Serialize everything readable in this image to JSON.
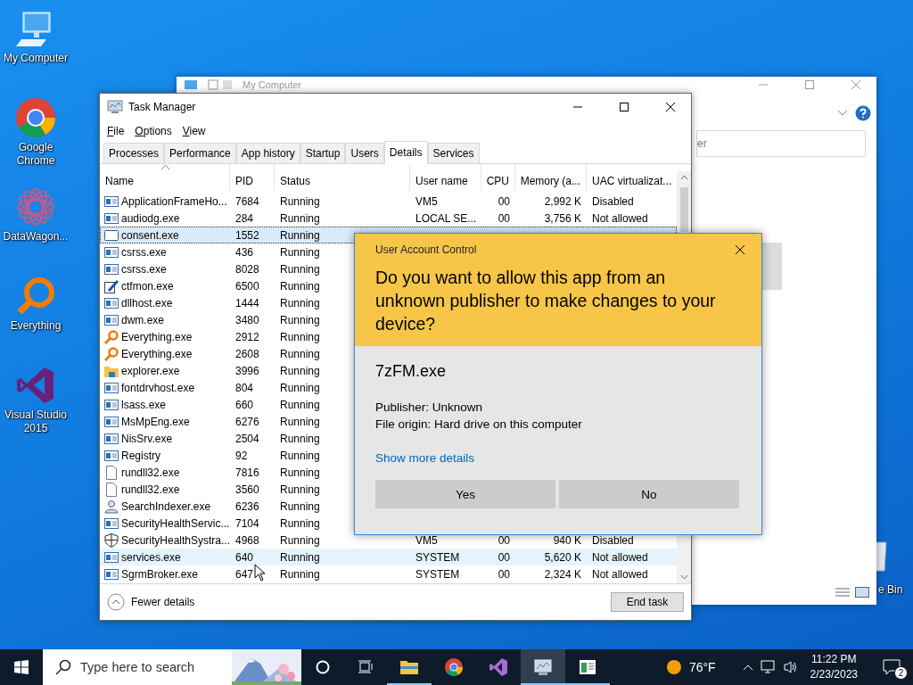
{
  "desktop_icons": [
    {
      "label": "My Computer",
      "kind": "monitor"
    },
    {
      "label": "Google Chrome",
      "kind": "chrome"
    },
    {
      "label": "DataWagon...",
      "kind": "flower"
    },
    {
      "label": "Everything",
      "kind": "magnifier"
    },
    {
      "label": "Visual Studio 2015",
      "kind": "vs"
    }
  ],
  "recycle_bin": {
    "label": "e Bin"
  },
  "explorer": {
    "title": "My Computer",
    "search_text": "er"
  },
  "task_manager": {
    "title": "Task Manager",
    "menu": [
      "File",
      "Options",
      "View"
    ],
    "tabs": [
      {
        "label": "Processes",
        "selected": false
      },
      {
        "label": "Performance",
        "selected": false
      },
      {
        "label": "App history",
        "selected": false
      },
      {
        "label": "Startup",
        "selected": false
      },
      {
        "label": "Users",
        "selected": false
      },
      {
        "label": "Details",
        "selected": true
      },
      {
        "label": "Services",
        "selected": false
      }
    ],
    "columns": [
      {
        "label": "Name",
        "sorted": true
      },
      {
        "label": "PID",
        "sorted": false
      },
      {
        "label": "Status",
        "sorted": false
      },
      {
        "label": "User name",
        "sorted": false
      },
      {
        "label": "CPU",
        "sorted": false
      },
      {
        "label": "Memory (a...",
        "sorted": false
      },
      {
        "label": "UAC virtualizat...",
        "sorted": false
      }
    ],
    "rows": [
      {
        "kind": "app",
        "cells": [
          "ApplicationFrameHo...",
          "7684",
          "Running",
          "VM5",
          "00",
          "2,992 K",
          "Disabled"
        ],
        "selected": false,
        "hovered": false
      },
      {
        "kind": "app",
        "cells": [
          "audiodg.exe",
          "284",
          "Running",
          "LOCAL SE...",
          "00",
          "3,756 K",
          "Not allowed"
        ],
        "selected": false,
        "hovered": false
      },
      {
        "kind": "frame",
        "cells": [
          "consent.exe",
          "1552",
          "Running"
        ],
        "selected": true,
        "hovered": false
      },
      {
        "kind": "app",
        "cells": [
          "csrss.exe",
          "436",
          "Running"
        ],
        "selected": false,
        "hovered": false
      },
      {
        "kind": "app",
        "cells": [
          "csrss.exe",
          "8028",
          "Running"
        ],
        "selected": false,
        "hovered": false
      },
      {
        "kind": "pen",
        "cells": [
          "ctfmon.exe",
          "6500",
          "Running"
        ],
        "selected": false,
        "hovered": false
      },
      {
        "kind": "app",
        "cells": [
          "dllhost.exe",
          "1444",
          "Running"
        ],
        "selected": false,
        "hovered": false
      },
      {
        "kind": "app",
        "cells": [
          "dwm.exe",
          "3480",
          "Running"
        ],
        "selected": false,
        "hovered": false
      },
      {
        "kind": "magnifier",
        "cells": [
          "Everything.exe",
          "2912",
          "Running"
        ],
        "selected": false,
        "hovered": false
      },
      {
        "kind": "magnifier",
        "cells": [
          "Everything.exe",
          "2608",
          "Running"
        ],
        "selected": false,
        "hovered": false
      },
      {
        "kind": "folder",
        "cells": [
          "explorer.exe",
          "3996",
          "Running"
        ],
        "selected": false,
        "hovered": false
      },
      {
        "kind": "app",
        "cells": [
          "fontdrvhost.exe",
          "804",
          "Running"
        ],
        "selected": false,
        "hovered": false
      },
      {
        "kind": "app",
        "cells": [
          "lsass.exe",
          "660",
          "Running"
        ],
        "selected": false,
        "hovered": false
      },
      {
        "kind": "app",
        "cells": [
          "MsMpEng.exe",
          "6276",
          "Running"
        ],
        "selected": false,
        "hovered": false
      },
      {
        "kind": "app",
        "cells": [
          "NisSrv.exe",
          "2504",
          "Running"
        ],
        "selected": false,
        "hovered": false
      },
      {
        "kind": "app",
        "cells": [
          "Registry",
          "92",
          "Running"
        ],
        "selected": false,
        "hovered": false
      },
      {
        "kind": "page",
        "cells": [
          "rundll32.exe",
          "7816",
          "Running"
        ],
        "selected": false,
        "hovered": false
      },
      {
        "kind": "page",
        "cells": [
          "rundll32.exe",
          "3560",
          "Running"
        ],
        "selected": false,
        "hovered": false
      },
      {
        "kind": "person",
        "cells": [
          "SearchIndexer.exe",
          "6236",
          "Running"
        ],
        "selected": false,
        "hovered": false
      },
      {
        "kind": "app",
        "cells": [
          "SecurityHealthServic...",
          "7104",
          "Running"
        ],
        "selected": false,
        "hovered": false
      },
      {
        "kind": "shield",
        "cells": [
          "SecurityHealthSystra...",
          "4968",
          "Running",
          "VM5",
          "00",
          "940 K",
          "Disabled"
        ],
        "selected": false,
        "hovered": false
      },
      {
        "kind": "app",
        "cells": [
          "services.exe",
          "640",
          "Running",
          "SYSTEM",
          "00",
          "5,620 K",
          "Not allowed"
        ],
        "selected": false,
        "hovered": true
      },
      {
        "kind": "app",
        "cells": [
          "SgrmBroker.exe",
          "647",
          "Running",
          "SYSTEM",
          "00",
          "2,324 K",
          "Not allowed"
        ],
        "selected": false,
        "hovered": false
      }
    ],
    "details_toggle": "Fewer details",
    "end_task": "End task"
  },
  "uac_dialog": {
    "title": "User Account Control",
    "question": "Do you want to allow this app from an unknown publisher to make changes to your device?",
    "app_name": "7zFM.exe",
    "publisher": "Publisher: Unknown",
    "file_origin": "File origin: Hard drive on this computer",
    "details_link": "Show more details",
    "buttons": [
      "Yes",
      "No"
    ]
  },
  "taskbar": {
    "search_placeholder": "Type here to search",
    "apps": [
      {
        "kind": "folder",
        "running": true,
        "selected": false
      },
      {
        "kind": "chrome",
        "running": false,
        "selected": false
      },
      {
        "kind": "vs",
        "running": false,
        "selected": false
      },
      {
        "kind": "monitor",
        "running": true,
        "selected": true
      },
      {
        "kind": "window",
        "running": true,
        "selected": false
      }
    ],
    "weather": "76°F",
    "time": "11:22 PM",
    "date": "2/23/2023",
    "notifications": "2"
  }
}
